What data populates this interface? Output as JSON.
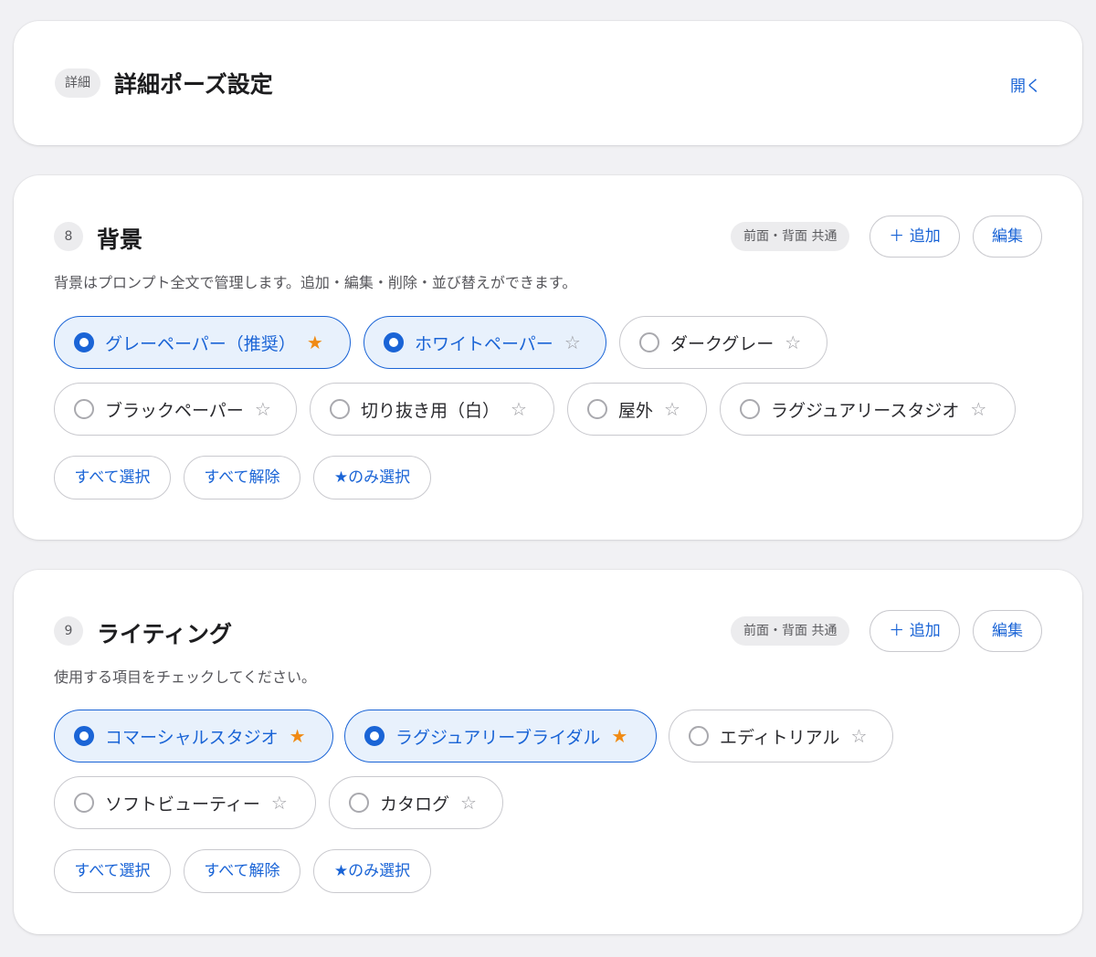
{
  "detail": {
    "badge": "詳細",
    "title": "詳細ポーズ設定",
    "open_label": "開く"
  },
  "sections": [
    {
      "number": "8",
      "title": "背景",
      "scope_tag": "前面・背面 共通",
      "add_label": "＋ 追加",
      "edit_label": "編集",
      "description": "背景はプロンプト全文で管理します。追加・編集・削除・並び替えができます。",
      "options": [
        {
          "label": "グレーペーパー（推奨）",
          "selected": true,
          "starred": true
        },
        {
          "label": "ホワイトペーパー",
          "selected": true,
          "starred": false
        },
        {
          "label": "ダークグレー",
          "selected": false,
          "starred": false
        },
        {
          "label": "ブラックペーパー",
          "selected": false,
          "starred": false
        },
        {
          "label": "切り抜き用（白）",
          "selected": false,
          "starred": false
        },
        {
          "label": "屋外",
          "selected": false,
          "starred": false
        },
        {
          "label": "ラグジュアリースタジオ",
          "selected": false,
          "starred": false
        }
      ],
      "actions": {
        "select_all": "すべて選択",
        "deselect_all": "すべて解除",
        "starred_only": "★のみ選択"
      }
    },
    {
      "number": "9",
      "title": "ライティング",
      "scope_tag": "前面・背面 共通",
      "add_label": "＋ 追加",
      "edit_label": "編集",
      "description": "使用する項目をチェックしてください。",
      "options": [
        {
          "label": "コマーシャルスタジオ",
          "selected": true,
          "starred": true
        },
        {
          "label": "ラグジュアリーブライダル",
          "selected": true,
          "starred": true
        },
        {
          "label": "エディトリアル",
          "selected": false,
          "starred": false
        },
        {
          "label": "ソフトビューティー",
          "selected": false,
          "starred": false
        },
        {
          "label": "カタログ",
          "selected": false,
          "starred": false
        }
      ],
      "actions": {
        "select_all": "すべて選択",
        "deselect_all": "すべて解除",
        "starred_only": "★のみ選択"
      }
    }
  ],
  "icons": {
    "star_filled": "★",
    "star_empty": "☆"
  },
  "colors": {
    "accent": "#1a64d6",
    "star_active": "#f08a14",
    "selected_bg": "#e8f1fc"
  }
}
